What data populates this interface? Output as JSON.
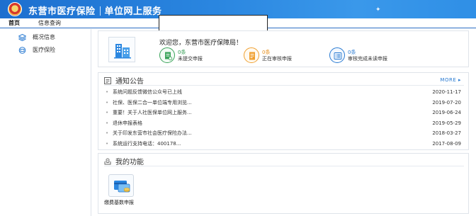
{
  "header": {
    "title_part1": "东营市医疗保险",
    "title_part2": "单位网上服务"
  },
  "nav": {
    "tabs": [
      {
        "label": "首页"
      },
      {
        "label": "信息查询"
      }
    ]
  },
  "sidebar": {
    "items": [
      {
        "label": "概况信息",
        "icon": "stack-icon"
      },
      {
        "label": "医疗保险",
        "icon": "card-icon"
      }
    ]
  },
  "welcome": {
    "greeting": "欢迎您，东营市医疗保障局！",
    "stats": [
      {
        "count": "0条",
        "label": "未提交申报",
        "color": "#3aa35a"
      },
      {
        "count": "0条",
        "label": "正在审核申报",
        "color": "#f0a030"
      },
      {
        "count": "0条",
        "label": "审核完成未读申报",
        "color": "#2a7bd2"
      }
    ]
  },
  "notices": {
    "title": "通知公告",
    "more": "MORE ▸",
    "items": [
      {
        "title": "系统问题反馈微信公众号已上线",
        "date": "2020-11-17"
      },
      {
        "title": "社保、医保二合一单位端专用浏览...",
        "date": "2019-07-20"
      },
      {
        "title": "重要！关于人社医保单位网上服务...",
        "date": "2019-06-24"
      },
      {
        "title": "退休申报表格",
        "date": "2019-05-29"
      },
      {
        "title": "关于印发东营市社会医疗保险办法...",
        "date": "2018-03-27"
      },
      {
        "title": "系统运行支持电话：400178...",
        "date": "2017-08-09"
      }
    ]
  },
  "functions": {
    "title": "我的功能",
    "items": [
      {
        "label": "缴费基数申报"
      }
    ]
  }
}
